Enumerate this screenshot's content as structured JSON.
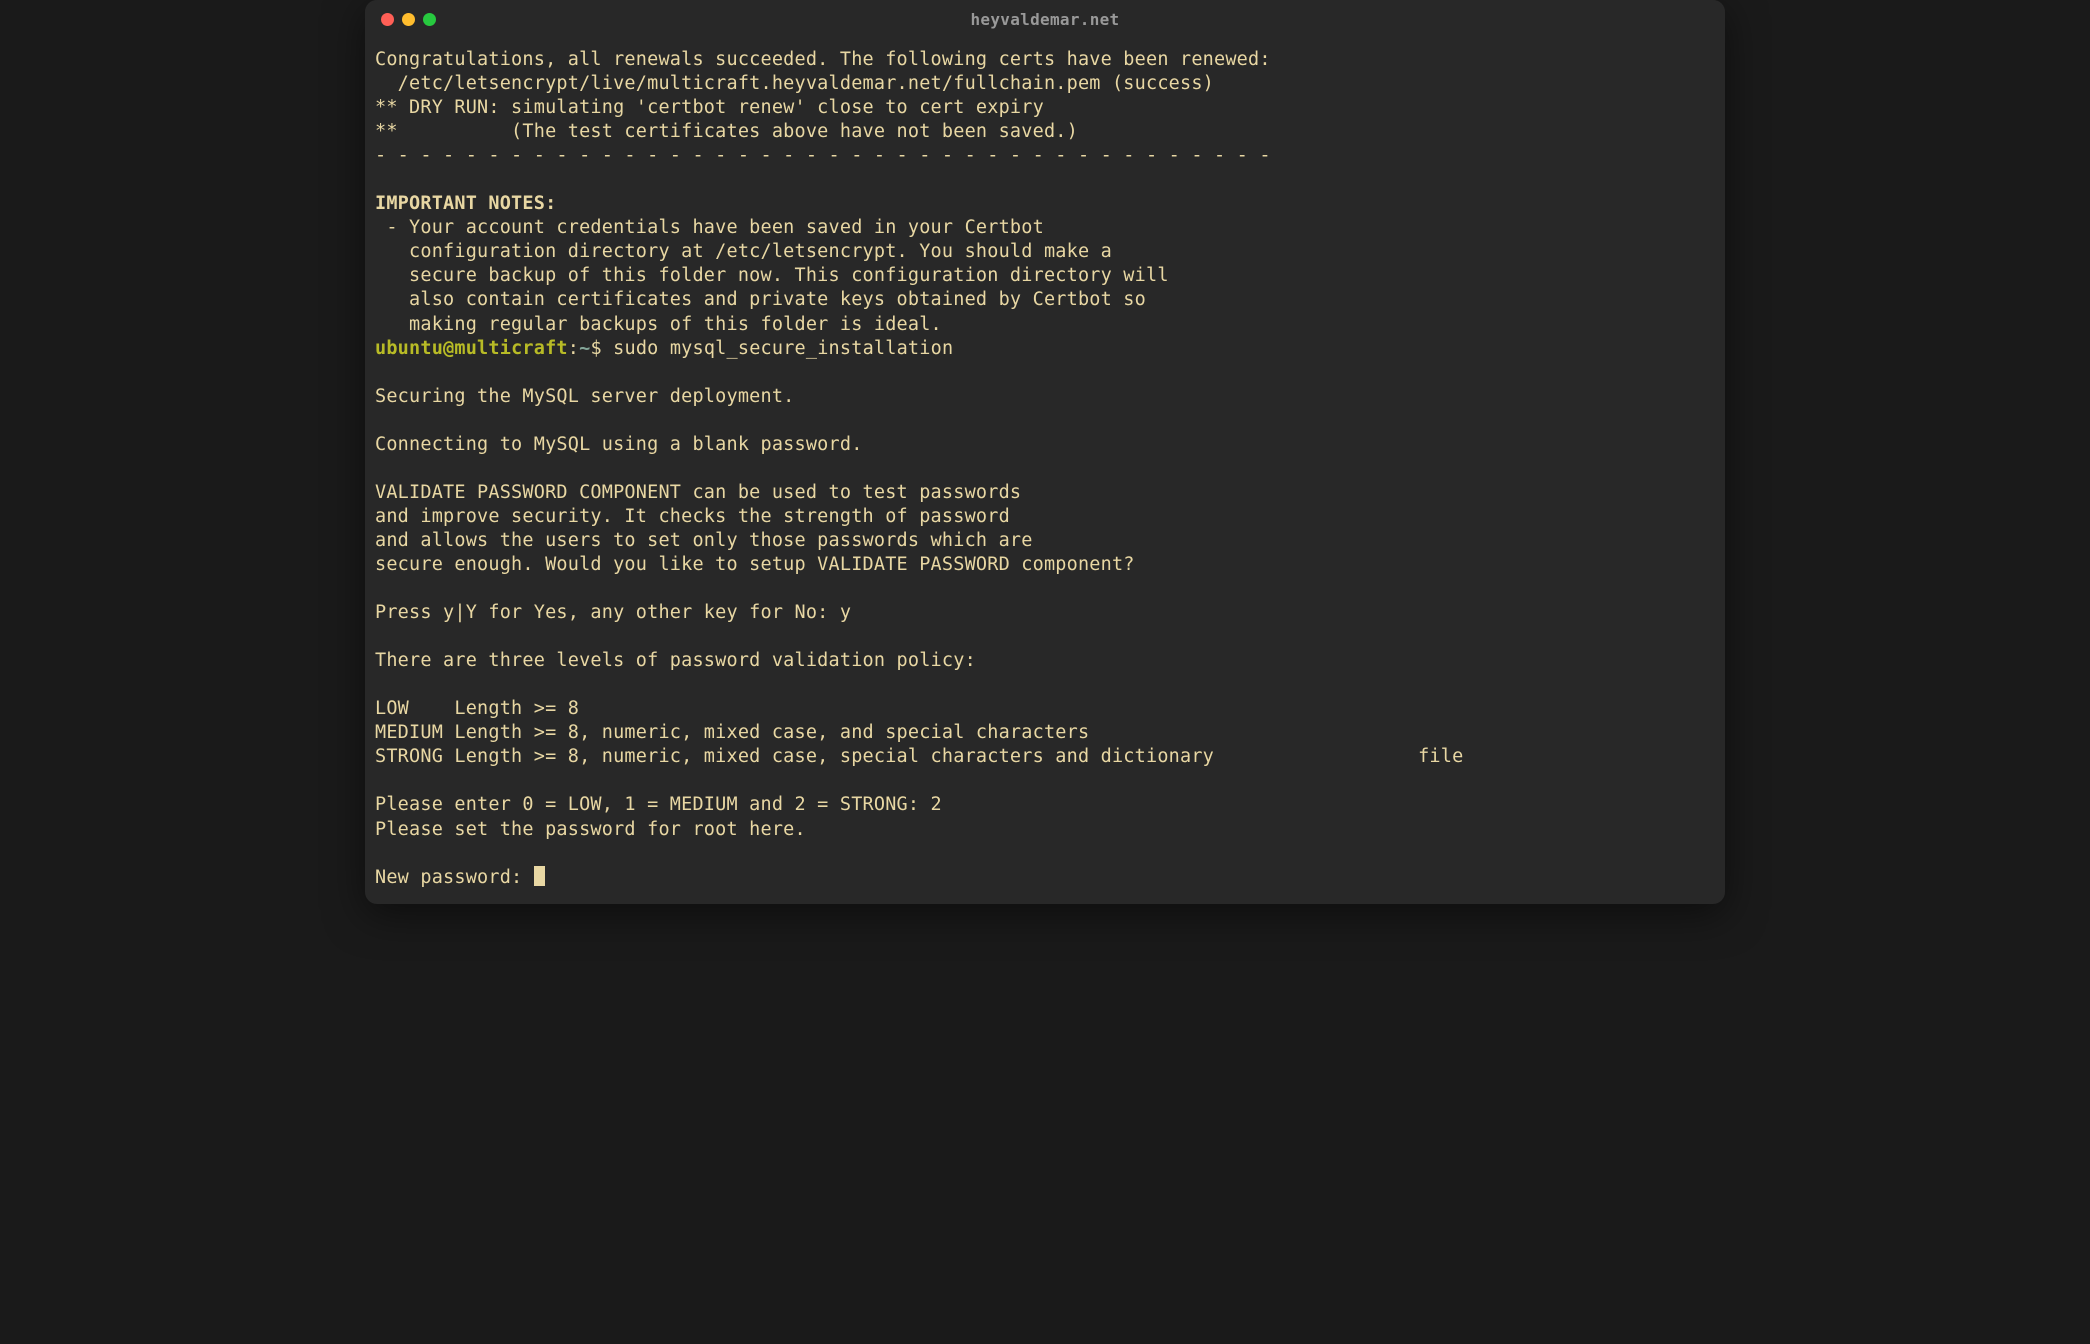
{
  "window": {
    "title": "heyvaldemar.net"
  },
  "output": {
    "line_congrats": "Congratulations, all renewals succeeded. The following certs have been renewed:",
    "line_cert_path": "  /etc/letsencrypt/live/multicraft.heyvaldemar.net/fullchain.pem (success)",
    "line_dryrun1": "** DRY RUN: simulating 'certbot renew' close to cert expiry",
    "line_dryrun2": "**          (The test certificates above have not been saved.)",
    "line_dashes": "- - - - - - - - - - - - - - - - - - - - - - - - - - - - - - - - - - - - - - - -",
    "important_header": "IMPORTANT NOTES:",
    "note_l1": " - Your account credentials have been saved in your Certbot",
    "note_l2": "   configuration directory at /etc/letsencrypt. You should make a",
    "note_l3": "   secure backup of this folder now. This configuration directory will",
    "note_l4": "   also contain certificates and private keys obtained by Certbot so",
    "note_l5": "   making regular backups of this folder is ideal."
  },
  "prompt": {
    "user": "ubuntu",
    "at": "@",
    "host": "multicraft",
    "colon": ":",
    "path": "~",
    "dollar": "$ ",
    "command": "sudo mysql_secure_installation"
  },
  "mysql": {
    "l1": "Securing the MySQL server deployment.",
    "l2": "Connecting to MySQL using a blank password.",
    "l3": "VALIDATE PASSWORD COMPONENT can be used to test passwords",
    "l4": "and improve security. It checks the strength of password",
    "l5": "and allows the users to set only those passwords which are",
    "l6": "secure enough. Would you like to setup VALIDATE PASSWORD component?",
    "l7": "Press y|Y for Yes, any other key for No: y",
    "l8": "There are three levels of password validation policy:",
    "l9": "LOW    Length >= 8",
    "l10": "MEDIUM Length >= 8, numeric, mixed case, and special characters",
    "l11": "STRONG Length >= 8, numeric, mixed case, special characters and dictionary                  file",
    "l12": "Please enter 0 = LOW, 1 = MEDIUM and 2 = STRONG: 2",
    "l13": "Please set the password for root here.",
    "l14": "New password: "
  }
}
